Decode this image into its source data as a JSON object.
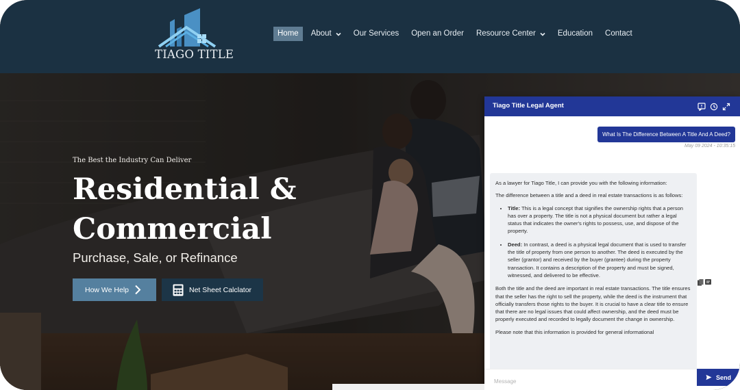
{
  "logo": {
    "text": "TIAGO TITLE"
  },
  "nav": {
    "items": [
      {
        "label": "Home",
        "active": true,
        "dropdown": false
      },
      {
        "label": "About",
        "active": false,
        "dropdown": true
      },
      {
        "label": "Our Services",
        "active": false,
        "dropdown": false
      },
      {
        "label": "Open an Order",
        "active": false,
        "dropdown": false
      },
      {
        "label": "Resource Center",
        "active": false,
        "dropdown": true
      },
      {
        "label": "Education",
        "active": false,
        "dropdown": false
      },
      {
        "label": "Contact",
        "active": false,
        "dropdown": false
      }
    ]
  },
  "hero": {
    "tagline": "The Best the Industry Can Deliver",
    "headline": "Residential & Commercial",
    "subhead": "Purchase, Sale, or Refinance",
    "help_button": "How We Help",
    "net_sheet_button": "Net Sheet Calclator"
  },
  "chat": {
    "title": "Tiago Title Legal Agent",
    "user_message": "What Is The Difference Between A Title And A Deed?",
    "user_time": "May 09 2024 - 10:35:15",
    "agent": {
      "intro": "As a lawyer for Tiago Title, I can provide you with the following information:",
      "para1": "The difference between a title and a deed in real estate transactions is as follows:",
      "bullet1_term": "Title:",
      "bullet1_text": " This is a legal concept that signifies the ownership rights that a person has over a property. The title is not a physical document but rather a legal status that indicates the owner's rights to possess, use, and dispose of the property.",
      "bullet2_term": "Deed:",
      "bullet2_text": " In contrast, a deed is a physical legal document that is used to transfer the title of property from one person to another. The deed is executed by the seller (grantor) and received by the buyer (grantee) during the property transaction. It contains a description of the property and must be signed, witnessed, and delivered to be effective.",
      "para2": "Both the title and the deed are important in real estate transactions. The title ensures that the seller has the right to sell the property, while the deed is the instrument that officially transfers those rights to the buyer. It is crucial to have a clear title to ensure that there are no legal issues that could affect ownership, and the deed must be properly executed and recorded to legally document the change in ownership.",
      "para3": "Please note that this information is provided for general informational"
    },
    "input_placeholder": "Message",
    "send_label": "Send"
  },
  "colors": {
    "header_bg": "#1b3142",
    "nav_active": "#5f7c92",
    "help_button": "#55809f",
    "net_button": "#1c3547",
    "chat_accent": "#223797"
  },
  "icons": [
    "chevron-down-icon",
    "chevron-right-icon",
    "calculator-icon",
    "chat-icon",
    "history-icon",
    "expand-icon",
    "copy-icon",
    "feedback-icon",
    "send-icon"
  ]
}
